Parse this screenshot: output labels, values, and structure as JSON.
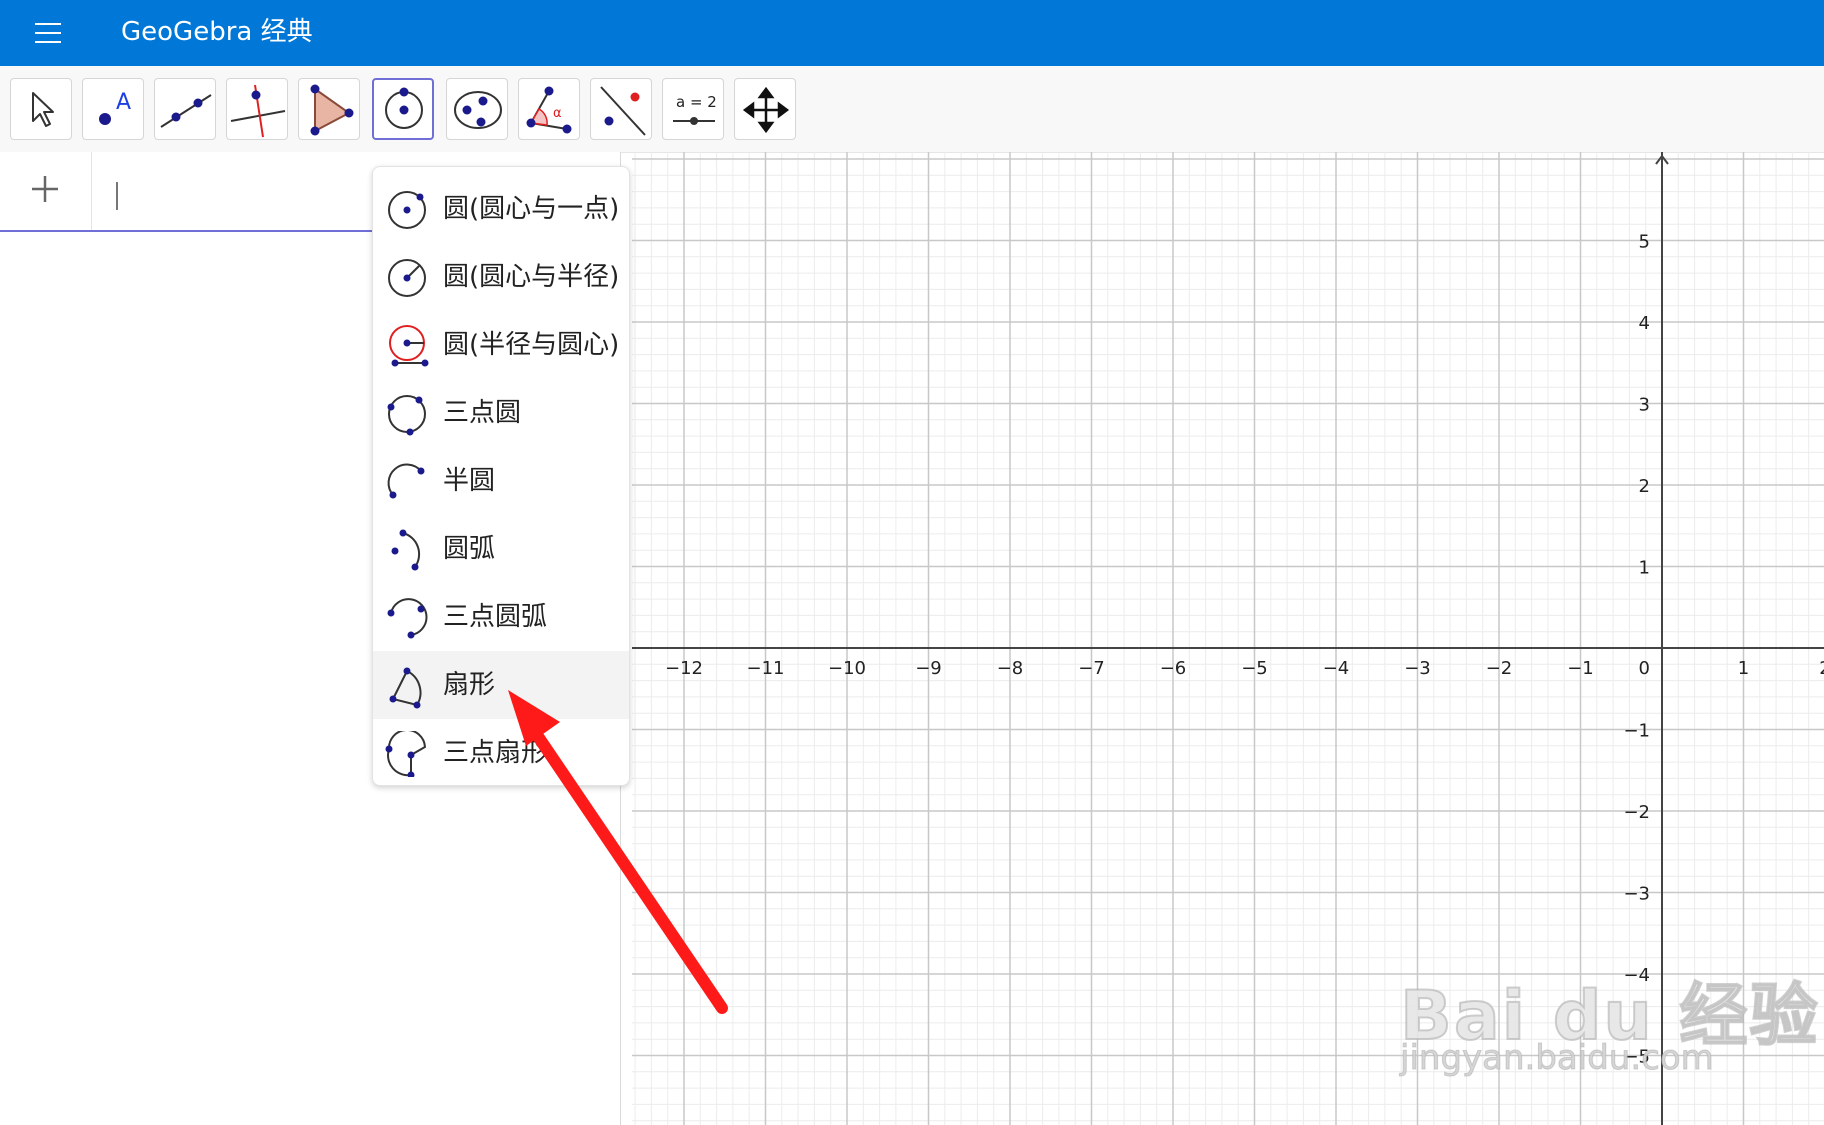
{
  "header": {
    "title": "GeoGebra 经典"
  },
  "toolbar": {
    "tools": [
      "move-tool",
      "point-tool",
      "line-tool",
      "perpendicular-tool",
      "polygon-tool",
      "circle-tool",
      "conic-tool",
      "angle-tool",
      "reflect-tool",
      "slider-tool",
      "move-view-tool"
    ],
    "active_tool": "circle-tool",
    "slider_tool_text": "a = 2",
    "point_tool_text": "A",
    "angle_tool_text": "α"
  },
  "algebra": {
    "add_label": "+"
  },
  "menu": {
    "items": [
      {
        "label": "圆(圆心与一点)",
        "icon": "circle-center-point-icon"
      },
      {
        "label": "圆(圆心与半径)",
        "icon": "circle-center-radius-icon"
      },
      {
        "label": "圆(半径与圆心)",
        "icon": "compass-icon"
      },
      {
        "label": "三点圆",
        "icon": "circle-three-points-icon"
      },
      {
        "label": "半圆",
        "icon": "semicircle-icon"
      },
      {
        "label": "圆弧",
        "icon": "circular-arc-icon"
      },
      {
        "label": "三点圆弧",
        "icon": "circumcircular-arc-icon"
      },
      {
        "label": "扇形",
        "icon": "circular-sector-icon"
      },
      {
        "label": "三点扇形",
        "icon": "circumcircular-sector-icon"
      }
    ],
    "selected_index": 7
  },
  "graphics": {
    "x_ticks": [
      "−12",
      "−11",
      "−10",
      "−9",
      "−8",
      "−7",
      "−6",
      "−5",
      "−4",
      "−3",
      "−2",
      "−1",
      "0",
      "1",
      "2"
    ],
    "y_ticks": [
      "5",
      "4",
      "3",
      "2",
      "1",
      "−1",
      "−2",
      "−3",
      "−4",
      "−5"
    ],
    "colors": {
      "axis": "#444444",
      "major_grid": "#c8c8c8",
      "minor_grid": "#ececec"
    }
  },
  "watermark": {
    "logo": "Bai du 经验",
    "url": "jingyan.baidu.com"
  },
  "annotation": {
    "color": "#ff1a1a"
  }
}
